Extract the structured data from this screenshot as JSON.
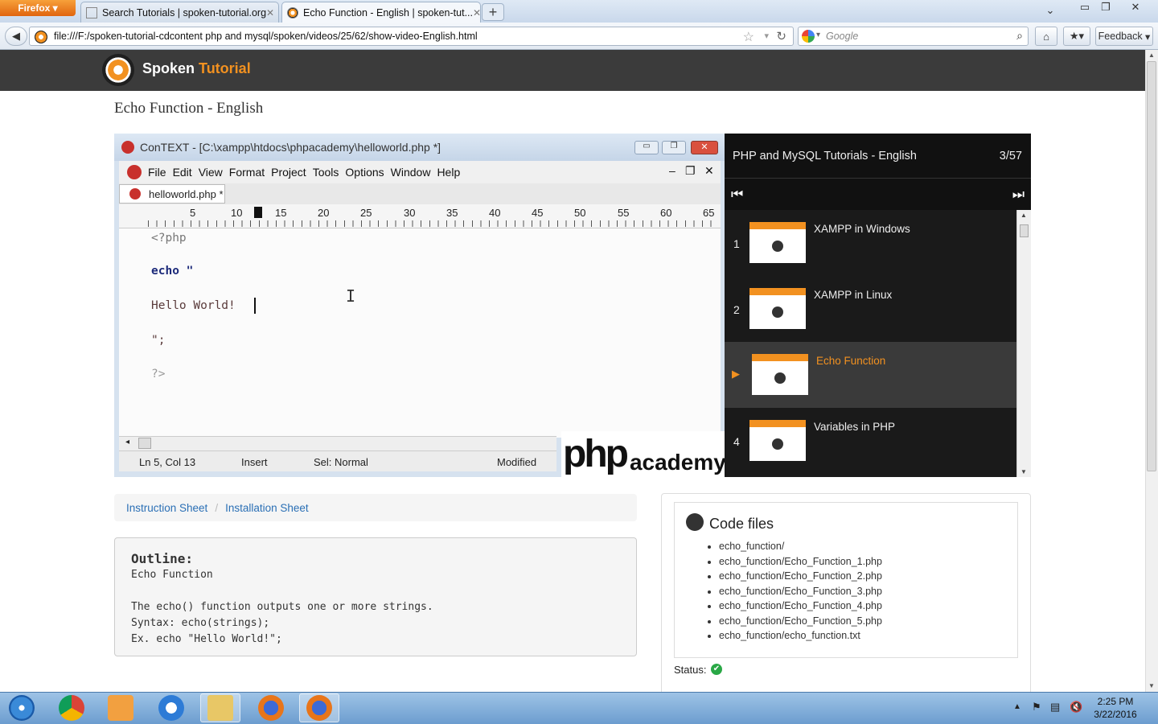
{
  "browser": {
    "menu_button": "Firefox",
    "tabs": [
      {
        "title": "Search Tutorials | spoken-tutorial.org",
        "active": false
      },
      {
        "title": "Echo Function - English | spoken-tut...",
        "active": true
      }
    ],
    "url": "file:///F:/spoken-tutorial-cdcontent php and mysql/spoken/videos/25/62/show-video-English.html",
    "search_placeholder": "Google",
    "feedback_label": "Feedback"
  },
  "site": {
    "brand_part1": "Spoken",
    "brand_part2": "Tutorial",
    "page_title": "Echo Function - English"
  },
  "video": {
    "window_title": "ConTEXT - [C:\\xampp\\htdocs\\phpacademy\\helloworld.php *]",
    "menu": [
      "File",
      "Edit",
      "View",
      "Format",
      "Project",
      "Tools",
      "Options",
      "Window",
      "Help"
    ],
    "file_tab": "helloworld.php *",
    "ruler_numbers": [
      "5",
      "10",
      "15",
      "20",
      "25",
      "30",
      "35",
      "40",
      "45",
      "50",
      "55",
      "60",
      "65"
    ],
    "code_lines": [
      "<?php",
      "echo \"",
      "Hello World!",
      "\";",
      "?>"
    ],
    "status": {
      "position": "Ln 5, Col 13",
      "mode": "Insert",
      "selection": "Sel: Normal",
      "state": "Modified"
    },
    "watermark_php": "php",
    "watermark_academy": "academy"
  },
  "playlist": {
    "title": "PHP and MySQL Tutorials - English",
    "counter": "3/57",
    "items": [
      {
        "num": "1",
        "name": "XAMPP in Windows",
        "active": false
      },
      {
        "num": "2",
        "name": "XAMPP in Linux",
        "active": false
      },
      {
        "num": "",
        "name": "Echo Function",
        "active": true
      },
      {
        "num": "4",
        "name": "Variables in PHP",
        "active": false
      }
    ]
  },
  "breadcrumb": {
    "items": [
      "Instruction Sheet",
      "Installation Sheet"
    ],
    "separator": "/"
  },
  "outline": {
    "heading": "Outline:",
    "lines": [
      "Echo Function",
      "",
      "The echo() function outputs one or more strings.",
      "Syntax: echo(strings);",
      "Ex. echo \"Hello World!\";"
    ]
  },
  "code_files": {
    "title": "Code files",
    "files": [
      "echo_function/",
      "echo_function/Echo_Function_1.php",
      "echo_function/Echo_Function_2.php",
      "echo_function/Echo_Function_3.php",
      "echo_function/Echo_Function_4.php",
      "echo_function/Echo_Function_5.php",
      "echo_function/echo_function.txt"
    ],
    "status_label": "Status:"
  },
  "taskbar": {
    "time": "2:25 PM",
    "date": "3/22/2016"
  },
  "colors": {
    "accent": "#f29120",
    "header_bg": "#3b3b3b",
    "link": "#2a6fb5",
    "playlist_bg": "#111111"
  }
}
